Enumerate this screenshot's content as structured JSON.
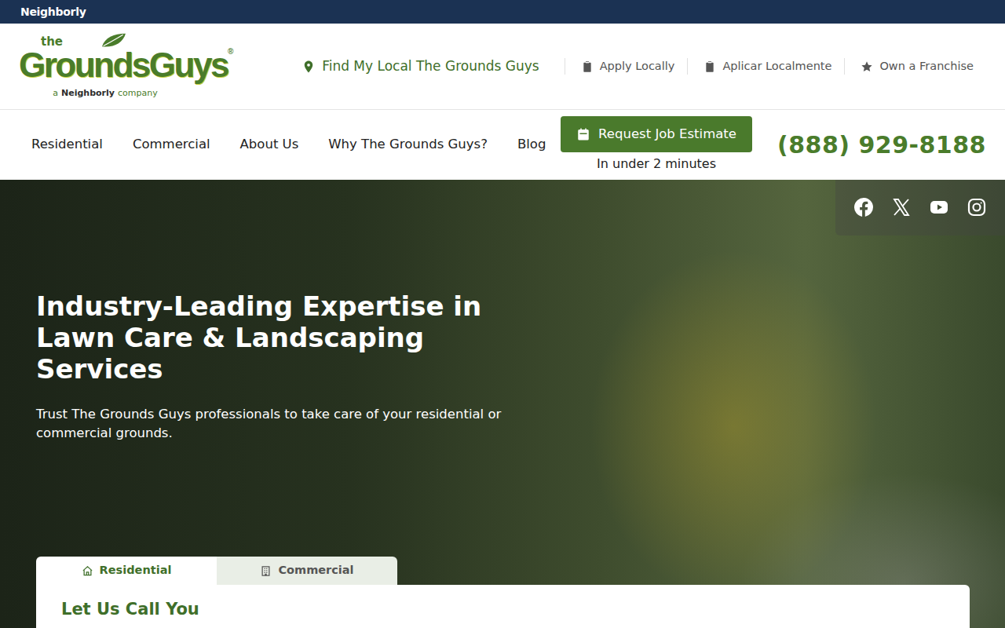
{
  "brand_bar": {
    "logo": "Neighborly"
  },
  "header": {
    "logo": {
      "small": "the",
      "word1": "Grounds",
      "word2": "Guys",
      "mark": "®",
      "tagline": {
        "prefix": "a",
        "brand": "Neighborly",
        "suffix": "company"
      }
    },
    "links": [
      {
        "label": "Find My Local The Grounds Guys",
        "kind": "locator"
      },
      {
        "label": "Apply Locally",
        "kind": "apply"
      },
      {
        "label": "Aplicar Localmente",
        "kind": "apply"
      },
      {
        "label": "Own a Franchise",
        "kind": "franchise"
      }
    ]
  },
  "nav": {
    "items": [
      "Residential",
      "Commercial",
      "About Us",
      "Why The Grounds Guys?",
      "Blog"
    ],
    "cta": {
      "label": "Request Job Estimate",
      "note": "In under 2 minutes"
    },
    "phone": "(888) 929-8188"
  },
  "hero": {
    "title": "Industry-Leading Expertise in Lawn Care & Landscaping Services",
    "subtitle": "Trust The Grounds Guys professionals to take care of your residential or commercial grounds.",
    "form": {
      "tabs": [
        {
          "label": "Residential",
          "kind": "home",
          "selected": true
        },
        {
          "label": "Commercial",
          "kind": "building",
          "selected": false
        }
      ],
      "heading": "Let Us Call You"
    }
  }
}
